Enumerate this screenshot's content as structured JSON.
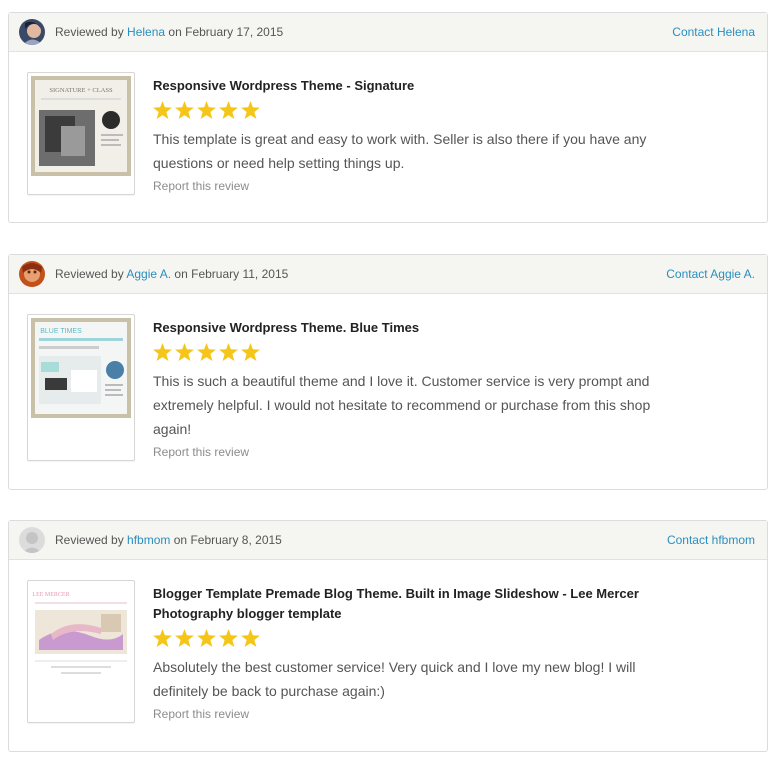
{
  "reviews": [
    {
      "reviewed_by_prefix": "Reviewed by",
      "reviewer": "Helena",
      "date_prefix": "on",
      "date": "February 17, 2015",
      "contact_label": "Contact Helena",
      "listing_title": "Responsive Wordpress Theme - Signature",
      "rating": 5,
      "text": "This template is great and easy to work with. Seller is also there if you have any questions or need help setting things up.",
      "report_label": "Report this review",
      "thumb_icon": "signature-theme-thumbnail",
      "thumb_text": "SIGNATURE + CLASS"
    },
    {
      "reviewed_by_prefix": "Reviewed by",
      "reviewer": "Aggie A.",
      "date_prefix": "on",
      "date": "February 11, 2015",
      "contact_label": "Contact Aggie A.",
      "listing_title": "Responsive Wordpress Theme. Blue Times",
      "rating": 5,
      "text": "This is such a beautiful theme and I love it. Customer service is very prompt and extremely helpful. I would not hesitate to recommend or purchase from this shop again!",
      "report_label": "Report this review",
      "thumb_icon": "blue-times-theme-thumbnail",
      "thumb_text": "BLUE TIMES"
    },
    {
      "reviewed_by_prefix": "Reviewed by",
      "reviewer": "hfbmom",
      "date_prefix": "on",
      "date": "February 8, 2015",
      "contact_label": "Contact hfbmom",
      "listing_title": "Blogger Template Premade Blog Theme. Built in Image Slideshow - Lee Mercer Photography blogger template",
      "rating": 5,
      "text": "Absolutely the best customer service! Very quick and I love my new blog! I will definitely be back to purchase again:)",
      "report_label": "Report this review",
      "thumb_icon": "lee-mercer-theme-thumbnail",
      "thumb_text": "LEE MERCER"
    }
  ],
  "colors": {
    "link": "#2a8fc0",
    "star": "#f5c518",
    "header_bg": "#f5f5f1",
    "border": "#dcdcdc"
  }
}
